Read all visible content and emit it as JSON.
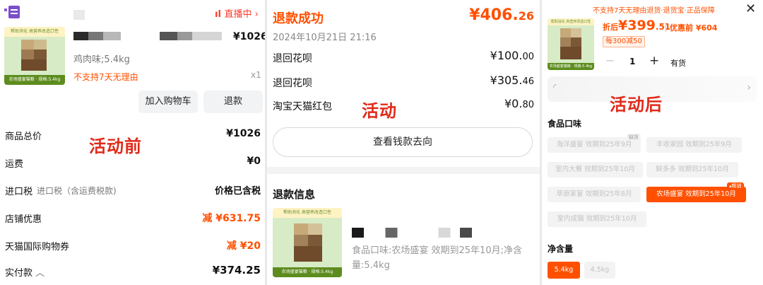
{
  "panel_before": {
    "live_label": "直播中",
    "product_price": "¥1026",
    "product_variant": "鸡肉味;5.4kg",
    "no_return_notice": "不支持7天无理由",
    "quantity": "x1",
    "add_to_cart_label": "加入购物车",
    "refund_button_label": "退款",
    "overlay_caption": "活动前",
    "rows": [
      {
        "label": "商品总价",
        "sublabel": "",
        "value": "¥1026",
        "discount": ""
      },
      {
        "label": "运费",
        "sublabel": "",
        "value": "¥0",
        "discount": ""
      },
      {
        "label": "进口税",
        "sublabel": "进口税（含运费税款)",
        "value": "价格已含税",
        "discount": ""
      },
      {
        "label": "店铺优惠",
        "sublabel": "",
        "value": "¥631.75",
        "discount": "减"
      },
      {
        "label": "天猫国际购物券",
        "sublabel": "",
        "value": "¥20",
        "discount": "减"
      },
      {
        "label": "实付款",
        "sublabel": "",
        "value": "¥374.25",
        "discount": ""
      }
    ]
  },
  "panel_refund": {
    "status_title": "退款成功",
    "total_amount_int": "¥406.",
    "total_amount_dec": "26",
    "date": "2024年10月21日 21:16",
    "overlay_caption": "活动",
    "lines": [
      {
        "label": "退回花呗",
        "value_int": "¥100.",
        "value_dec": "00"
      },
      {
        "label": "退回花呗",
        "value_int": "¥305.",
        "value_dec": "46"
      },
      {
        "label": "淘宝天猫红包",
        "value_int": "¥0.",
        "value_dec": "80"
      }
    ],
    "view_money_button": "查看钱款去向",
    "refund_info_title": "退款信息",
    "product_desc": "食品口味:农场盛宴 效期到25年10月;净含量:5.4kg"
  },
  "panel_after": {
    "service_notice": "不支持7天无理由退货·退货宝·正品保障",
    "close_icon": "close-icon",
    "discount_price_prefix": "折后",
    "discount_price_int": "¥399",
    "discount_price_dec": ".51",
    "original_price": "优惠前 ¥604",
    "coupon_tag": "每300减50",
    "qty_minus": "−",
    "qty_value": "1",
    "qty_plus": "+",
    "stock_status": "有货",
    "overlay_caption": "活动后",
    "flavor_section_title": "食品口味",
    "flavor_options": [
      {
        "label": "海洋盛宴 效期到25年9月",
        "badge": "缺货"
      },
      {
        "label": "丰收家园 效期到25年9月",
        "badge": ""
      },
      {
        "label": "室内大餐 效期到25年10月",
        "badge": ""
      },
      {
        "label": "鲜多多 效期到25年10月",
        "badge": ""
      },
      {
        "label": "草原家宴 效期到25年8月",
        "badge": ""
      },
      {
        "label": "农场盛宴 效期到25年10月",
        "badge": "畅销"
      },
      {
        "label": "室内成猫 效期到25年10月",
        "badge": ""
      }
    ],
    "net_weight_title": "净含量",
    "weight_options": [
      "5.4kg",
      "4.5kg"
    ]
  },
  "thumbnail": {
    "banner_text": "帮助消化 高营养改造口性",
    "footer_text": "农场盛宴猫粮 · 规格:5.4kg"
  },
  "colors": {
    "accent": "#ff5000",
    "overlay_red": "#e02a1a",
    "thumb_green": "#5d8c1e"
  }
}
